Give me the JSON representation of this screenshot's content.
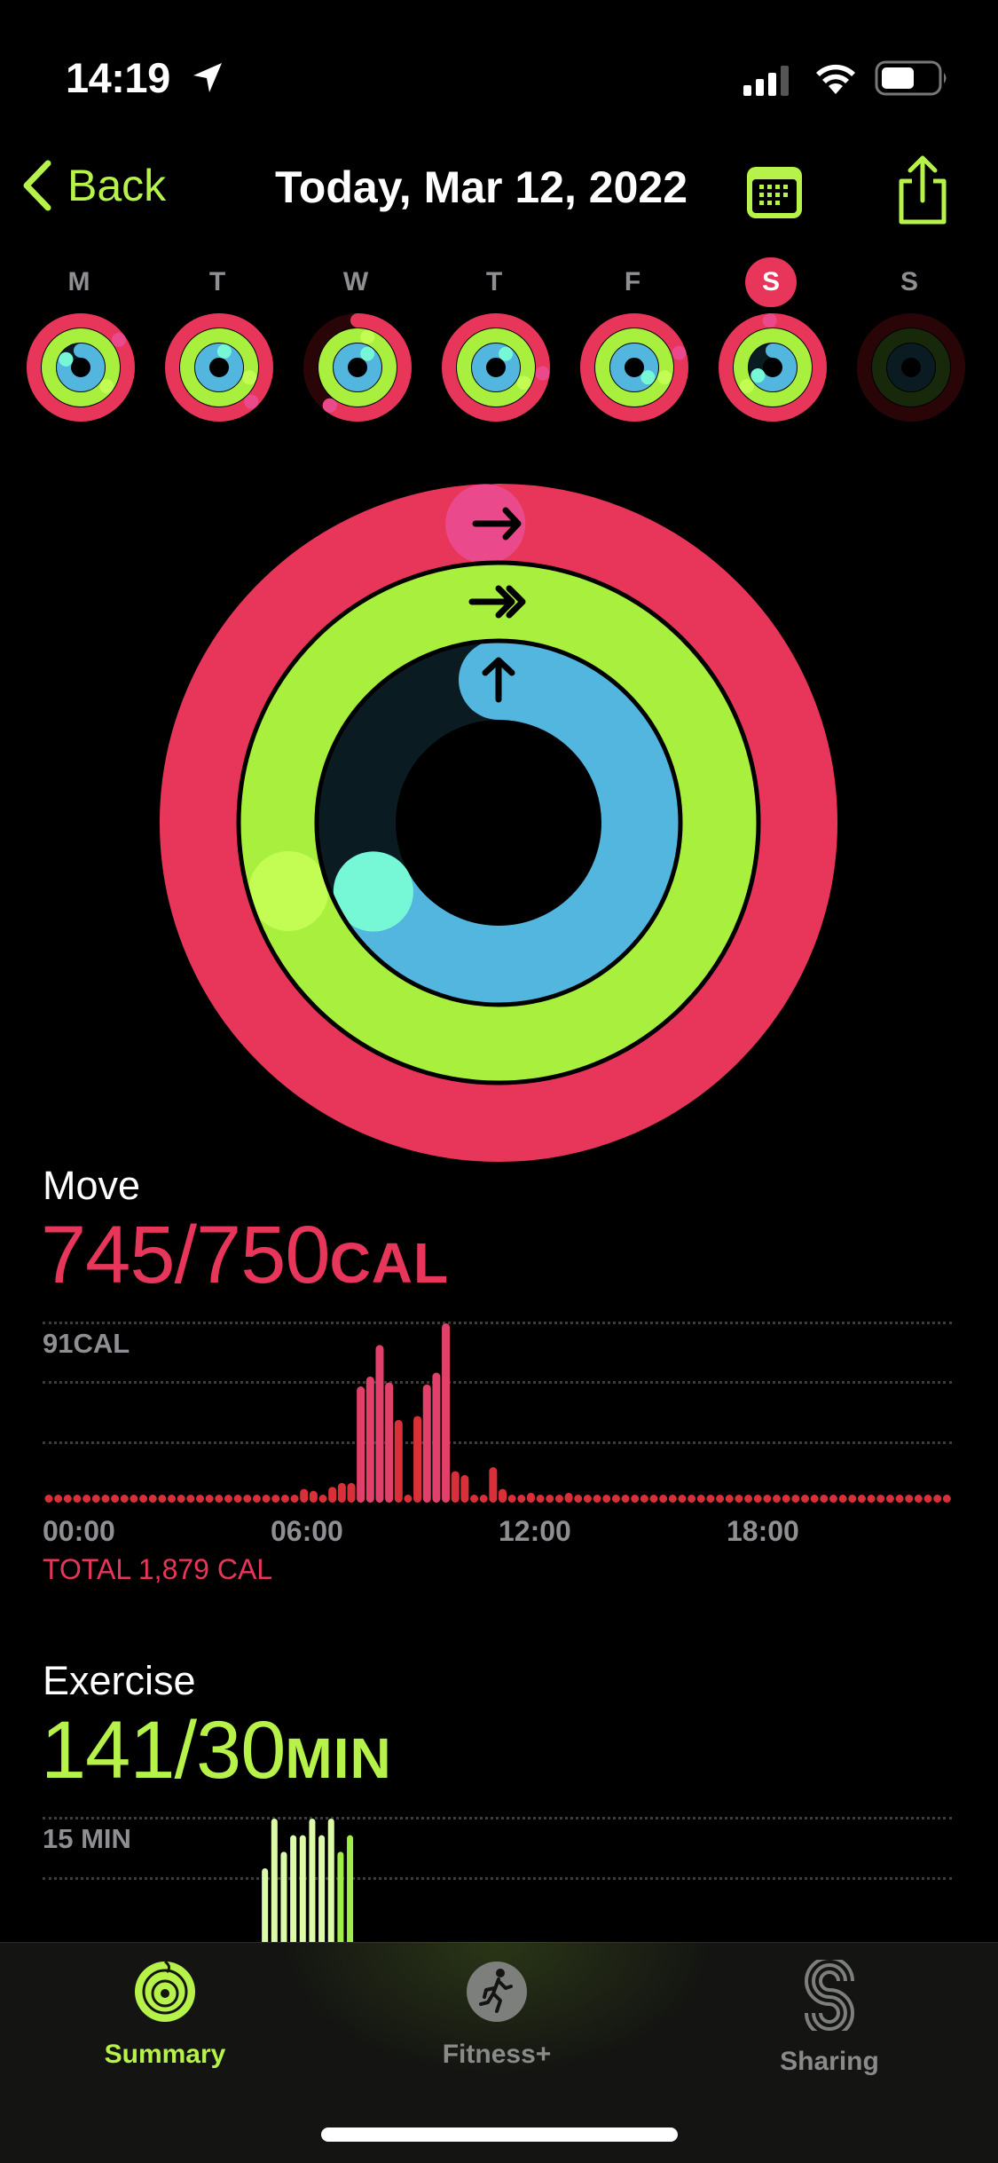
{
  "status_bar": {
    "time": "14:19",
    "icons": [
      "location-arrow-icon",
      "cellular-signal-icon",
      "wifi-icon",
      "battery-icon"
    ]
  },
  "nav": {
    "back_label": "Back",
    "title": "Today, Mar 12, 2022",
    "calendar_icon": "calendar-icon",
    "share_icon": "share-icon"
  },
  "week": [
    {
      "label": "M",
      "selected": false,
      "move": 1.15,
      "exercise": 1.35,
      "stand": 0.83
    },
    {
      "label": "T",
      "selected": false,
      "move": 1.38,
      "exercise": 1.3,
      "stand": 1.05
    },
    {
      "label": "W",
      "selected": false,
      "move": 0.6,
      "exercise": 1.05,
      "stand": 1.1
    },
    {
      "label": "T",
      "selected": false,
      "move": 1.27,
      "exercise": 1.33,
      "stand": 1.1
    },
    {
      "label": "F",
      "selected": false,
      "move": 1.2,
      "exercise": 1.3,
      "stand": 1.35
    },
    {
      "label": "S",
      "selected": true,
      "move": 0.99,
      "exercise": 1.65,
      "stand": 0.67
    },
    {
      "label": "S",
      "selected": false,
      "move": 0,
      "exercise": 0,
      "stand": 0
    }
  ],
  "rings": {
    "move": {
      "progress": 0.993,
      "colors": [
        "#e8365a",
        "#ea4a8c"
      ]
    },
    "exercise": {
      "progress": 4.7,
      "colors": [
        "#a8ef3e",
        "#c3fc52"
      ]
    },
    "stand": {
      "progress": 0.67,
      "colors": [
        "#52b6de",
        "#76f8d7"
      ]
    }
  },
  "move": {
    "title": "Move",
    "value": "745/750",
    "unit": "CAL",
    "color": "#e8365a",
    "max_label": "91CAL",
    "total": "TOTAL 1,879 CAL",
    "x_labels": [
      "00:00",
      "06:00",
      "12:00",
      "18:00"
    ]
  },
  "exercise": {
    "title": "Exercise",
    "value": "141/30",
    "unit": "MIN",
    "color": "#b6f24a",
    "max_label": "15 MIN"
  },
  "tabs": [
    {
      "label": "Summary",
      "icon": "activity-rings-icon",
      "active": true
    },
    {
      "label": "Fitness+",
      "icon": "running-figure-icon",
      "active": false
    },
    {
      "label": "Sharing",
      "icon": "sharing-s-icon",
      "active": false
    }
  ],
  "chart_data": [
    {
      "type": "bar",
      "title": "Move",
      "ylabel": "CAL",
      "xlabel": "",
      "x_tick_labels": [
        "00:00",
        "06:00",
        "12:00",
        "18:00"
      ],
      "ylim": [
        0,
        91
      ],
      "interval_minutes": 15,
      "values": [
        0,
        0,
        0,
        0,
        0,
        0,
        0,
        0,
        0,
        0,
        0,
        0,
        0,
        0,
        0,
        0,
        0,
        0,
        0,
        0,
        0,
        0,
        0,
        0,
        0,
        0,
        0,
        7,
        6,
        1,
        8,
        10,
        10,
        59,
        64,
        80,
        61,
        42,
        4,
        44,
        60,
        66,
        91,
        16,
        14,
        4,
        3,
        18,
        7,
        0,
        0,
        5,
        0,
        0,
        1,
        5,
        0,
        0,
        0,
        0,
        0,
        0,
        0,
        0,
        0,
        0,
        0,
        0,
        0,
        0,
        0,
        0,
        0,
        0,
        0,
        0,
        0,
        0,
        0,
        0,
        0,
        0,
        0,
        0,
        0,
        0,
        0,
        0,
        0,
        0,
        0,
        0,
        0,
        0,
        0,
        0
      ],
      "annotations": [
        "TOTAL 1,879 CAL"
      ]
    },
    {
      "type": "bar",
      "title": "Exercise",
      "ylabel": "MIN",
      "xlabel": "",
      "ylim": [
        0,
        15
      ],
      "interval_minutes": 15,
      "start_slot": 33,
      "values": [
        9,
        15,
        11,
        13,
        13,
        15,
        13,
        15,
        11,
        13
      ]
    }
  ]
}
